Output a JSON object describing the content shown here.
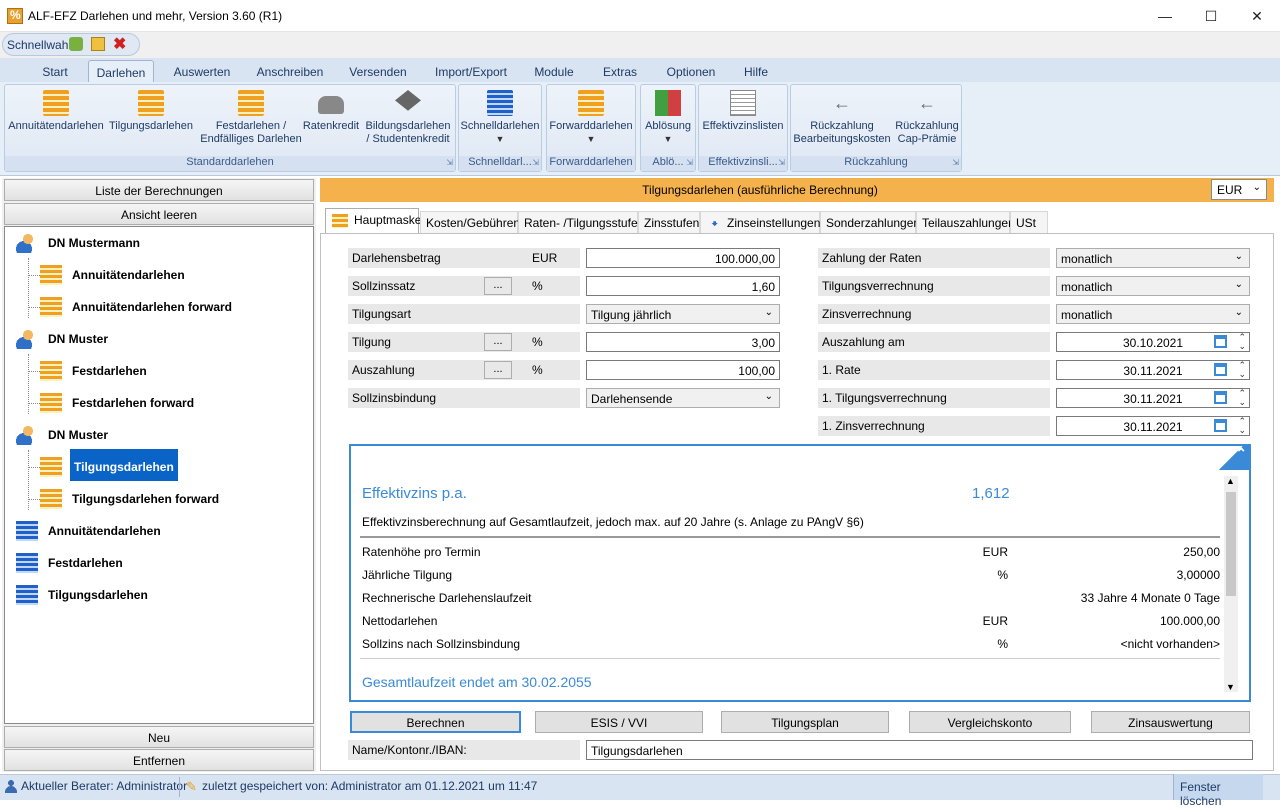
{
  "window": {
    "title": "ALF-EFZ Darlehen und mehr, Version 3.60 (R1)"
  },
  "quick": {
    "label": "Schnellwahl"
  },
  "ribbon_tabs": [
    "Start",
    "Darlehen",
    "Auswerten",
    "Anschreiben",
    "Versenden",
    "Import/Export",
    "Module",
    "Extras",
    "Optionen",
    "Hilfe"
  ],
  "ribbon": {
    "b_annuitaet": "Annuitätendarlehen",
    "b_tilgung": "Tilgungsdarlehen",
    "b_fest1": "Festdarlehen /",
    "b_fest2": "Endfälliges Darlehen",
    "b_raten": "Ratenkredit",
    "b_bild1": "Bildungsdarlehen",
    "b_bild2": "/ Studentenkredit",
    "g_standard": "Standarddarlehen",
    "b_schnell": "Schnelldarlehen",
    "g_schnell": "Schnelldarl...",
    "b_forward": "Forwarddarlehen",
    "g_forward": "Forwarddarlehen",
    "b_abloesung": "Ablösung",
    "g_abloesung": "Ablö...",
    "b_effekt": "Effektivzinslisten",
    "g_effekt": "Effektivzinsli...",
    "b_rb1": "Rückzahlung",
    "b_rb2": "Bearbeitungskosten",
    "b_rc1": "Rückzahlung",
    "b_rc2": "Cap-Prämie",
    "g_rueck": "Rückzahlung"
  },
  "left": {
    "btn_list": "Liste der Berechnungen",
    "btn_clear": "Ansicht leeren",
    "tree": [
      {
        "label": "DN Mustermann",
        "level": 0,
        "icon": "person-icon"
      },
      {
        "label": "Annuitätendarlehen",
        "level": 1,
        "icon": "stack-icon"
      },
      {
        "label": "Annuitätendarlehen forward",
        "level": 1,
        "icon": "stack-icon"
      },
      {
        "label": "DN Muster",
        "level": 0,
        "icon": "person-icon"
      },
      {
        "label": "Festdarlehen",
        "level": 1,
        "icon": "stack-icon"
      },
      {
        "label": "Festdarlehen forward",
        "level": 1,
        "icon": "stack-icon"
      },
      {
        "label": "DN Muster",
        "level": 0,
        "icon": "person-icon"
      },
      {
        "label": "Tilgungsdarlehen",
        "level": 1,
        "icon": "stack-icon",
        "selected": true
      },
      {
        "label": "Tilgungsdarlehen forward",
        "level": 1,
        "icon": "stack-icon"
      },
      {
        "label": "Annuitätendarlehen",
        "level": 0,
        "icon": "blue-stack-icon"
      },
      {
        "label": "Festdarlehen",
        "level": 0,
        "icon": "blue-stack-icon"
      },
      {
        "label": "Tilgungsdarlehen",
        "level": 0,
        "icon": "blue-stack-icon"
      }
    ],
    "btn_new": "Neu",
    "btn_remove": "Entfernen"
  },
  "main": {
    "header": "Tilgungsdarlehen (ausführliche Berechnung)",
    "currency": "EUR",
    "tabs": [
      "Hauptmaske",
      "Kosten/Gebühren",
      "Raten- /Tilgungsstufen",
      "Zinsstufen",
      "Zinseinstellungen",
      "Sonderzahlungen",
      "Teilauszahlungen",
      "USt"
    ]
  },
  "form": {
    "darlehensbetrag_label": "Darlehensbetrag",
    "darlehensbetrag_unit": "EUR",
    "darlehensbetrag_value": "100.000,00",
    "sollzins_label": "Sollzinssatz",
    "sollzins_unit": "%",
    "sollzins_value": "1,60",
    "tilgungsart_label": "Tilgungsart",
    "tilgungsart_value": "Tilgung jährlich",
    "tilgung_label": "Tilgung",
    "tilgung_unit": "%",
    "tilgung_value": "3,00",
    "auszahlung_label": "Auszahlung",
    "auszahlung_unit": "%",
    "auszahlung_value": "100,00",
    "bindung_label": "Sollzinsbindung",
    "bindung_value": "Darlehensende",
    "dots": "...",
    "zahlung_label": "Zahlung der Raten",
    "zahlung_value": "monatlich",
    "tverr_label": "Tilgungsverrechnung",
    "tverr_value": "monatlich",
    "zverr_label": "Zinsverrechnung",
    "zverr_value": "monatlich",
    "ausz_am_label": "Auszahlung am",
    "ausz_am_value": "30.10.2021",
    "rate1_label": "1. Rate",
    "rate1_value": "30.11.2021",
    "tv1_label": "1. Tilgungsverrechnung",
    "tv1_value": "30.11.2021",
    "zv1_label": "1. Zinsverrechnung",
    "zv1_value": "30.11.2021"
  },
  "result": {
    "eff_label": "Effektivzins p.a.",
    "eff_value": "1,612",
    "note": "Effektivzinsberechnung auf Gesamtlaufzeit, jedoch max. auf 20 Jahre (s. Anlage zu PAngV §6)",
    "rows": [
      {
        "label": "Ratenhöhe pro Termin",
        "unit": "EUR",
        "value": "250,00"
      },
      {
        "label": "Jährliche Tilgung",
        "unit": "%",
        "value": "3,00000"
      },
      {
        "label": "Rechnerische Darlehenslaufzeit",
        "unit": "",
        "value": "33 Jahre 4 Monate 0 Tage"
      },
      {
        "label": "Nettodarlehen",
        "unit": "EUR",
        "value": "100.000,00"
      },
      {
        "label": "Sollzins nach Sollzinsbindung",
        "unit": "%",
        "value": "<nicht vorhanden>"
      }
    ],
    "end": "Gesamtlaufzeit endet am 30.02.2055"
  },
  "buttons": {
    "berechnen": "Berechnen",
    "esis": "ESIS / VVI",
    "plan": "Tilgungsplan",
    "vergleich": "Vergleichskonto",
    "zins": "Zinsauswertung"
  },
  "name": {
    "label": "Name/Kontonr./IBAN:",
    "value": "Tilgungsdarlehen"
  },
  "status": {
    "berater": "Aktueller Berater: Administrator",
    "saved": "zuletzt gespeichert von: Administrator am 01.12.2021 um 11:47",
    "clear": "Fenster löschen"
  }
}
